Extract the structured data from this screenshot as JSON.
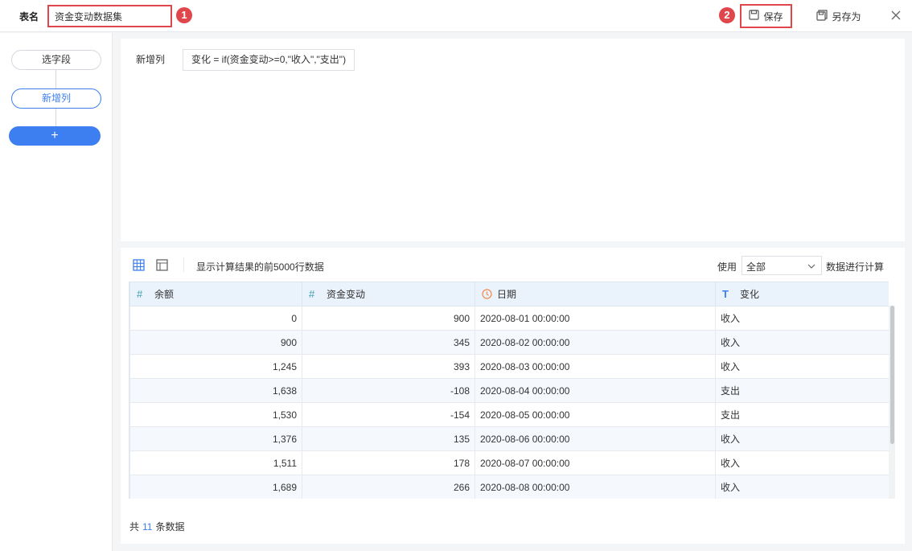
{
  "header": {
    "table_name_label": "表名",
    "table_name_value": "资金变动数据集",
    "badge_1": "1",
    "badge_2": "2",
    "save_label": "保存",
    "save_as_label": "另存为"
  },
  "sidebar": {
    "steps": [
      {
        "label": "选字段"
      },
      {
        "label": "新增列"
      }
    ],
    "add_label": "+"
  },
  "formula": {
    "label": "新增列",
    "expression": "变化 = if(资金变动>=0,\"收入\",\"支出\")"
  },
  "data_preview": {
    "info": "显示计算结果的前5000行数据",
    "use_label": "使用",
    "scope_value": "全部",
    "calc_label": "数据进行计算",
    "columns": [
      {
        "type_icon": "#",
        "name": "余额"
      },
      {
        "type_icon": "#",
        "name": "资金变动"
      },
      {
        "type_icon": "clock-icon",
        "name": "日期"
      },
      {
        "type_icon": "T",
        "name": "变化"
      }
    ],
    "rows": [
      [
        "0",
        "900",
        "2020-08-01 00:00:00",
        "收入"
      ],
      [
        "900",
        "345",
        "2020-08-02 00:00:00",
        "收入"
      ],
      [
        "1,245",
        "393",
        "2020-08-03 00:00:00",
        "收入"
      ],
      [
        "1,638",
        "-108",
        "2020-08-04 00:00:00",
        "支出"
      ],
      [
        "1,530",
        "-154",
        "2020-08-05 00:00:00",
        "支出"
      ],
      [
        "1,376",
        "135",
        "2020-08-06 00:00:00",
        "收入"
      ],
      [
        "1,511",
        "178",
        "2020-08-07 00:00:00",
        "收入"
      ],
      [
        "1,689",
        "266",
        "2020-08-08 00:00:00",
        "收入"
      ]
    ],
    "total_prefix": "共",
    "total_count": "11",
    "total_suffix": "条数据"
  },
  "colors": {
    "accent": "#3d7ff0",
    "highlight": "#e0474c"
  }
}
